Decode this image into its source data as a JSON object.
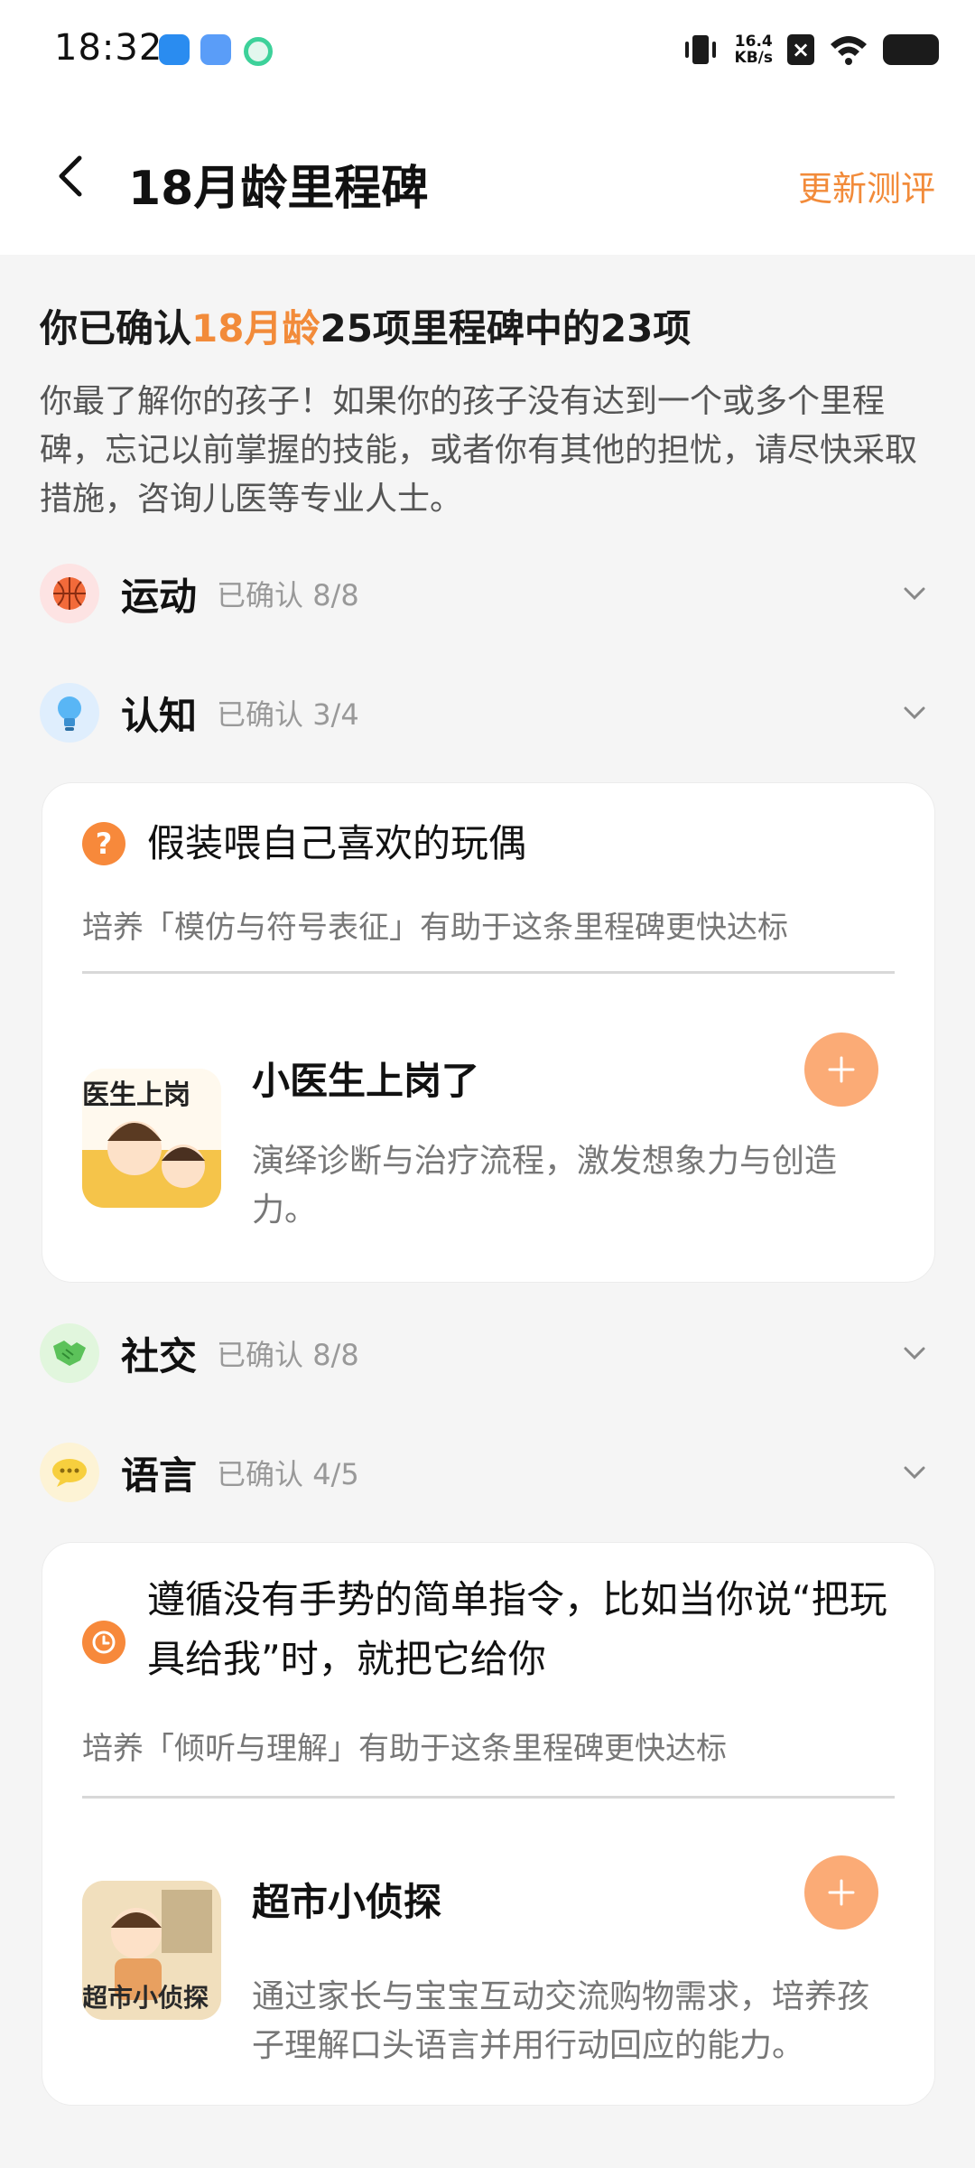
{
  "status": {
    "time": "18:32",
    "net_speed_value": "16.4",
    "net_speed_unit": "KB/s",
    "icons": [
      "app-blue-icon",
      "app-files-icon",
      "app-green-icon",
      "vibrate-icon",
      "sim-off-icon",
      "wifi-icon",
      "battery-icon"
    ]
  },
  "header": {
    "title": "18月龄里程碑",
    "action": "更新测评"
  },
  "summary": {
    "prefix": "你已确认",
    "highlight": "18月龄",
    "suffix": "25项里程碑中的23项"
  },
  "intro": "你最了解你的孩子！如果你的孩子没有达到一个或多个里程碑，忘记以前掌握的技能，或者你有其他的担忧，请尽快采取措施，咨询儿医等专业人士。",
  "categories": [
    {
      "name": "运动",
      "count": "已确认 8/8",
      "icon": "basketball-icon"
    },
    {
      "name": "认知",
      "count": "已确认 3/4",
      "icon": "lightbulb-icon"
    },
    {
      "name": "社交",
      "count": "已确认 8/8",
      "icon": "handshake-icon"
    },
    {
      "name": "语言",
      "count": "已确认 4/5",
      "icon": "speech-bubble-icon"
    }
  ],
  "cards": [
    {
      "milestone_icon": "question-icon",
      "milestone": "假装喂自己喜欢的玩偶",
      "hint": "培养「模仿与符号表征」有助于这条里程碑更快达标",
      "activity": {
        "title": "小医生上岗了",
        "desc": "演绎诊断与治疗流程，激发想象力与创造力。",
        "thumb_text": "医生上岗"
      }
    },
    {
      "milestone_icon": "clock-icon",
      "milestone": "遵循没有手势的简单指令，比如当你说“把玩具给我”时，就把它给你",
      "hint": "培养「倾听与理解」有助于这条里程碑更快达标",
      "activity": {
        "title": "超市小侦探",
        "desc": "通过家长与宝宝互动交流购物需求，培养孩子理解口头语言并用行动回应的能力。",
        "thumb_text": "超市小侦探"
      }
    }
  ],
  "colors": {
    "accent": "#f28b3a",
    "add_button": "#fbab76"
  }
}
